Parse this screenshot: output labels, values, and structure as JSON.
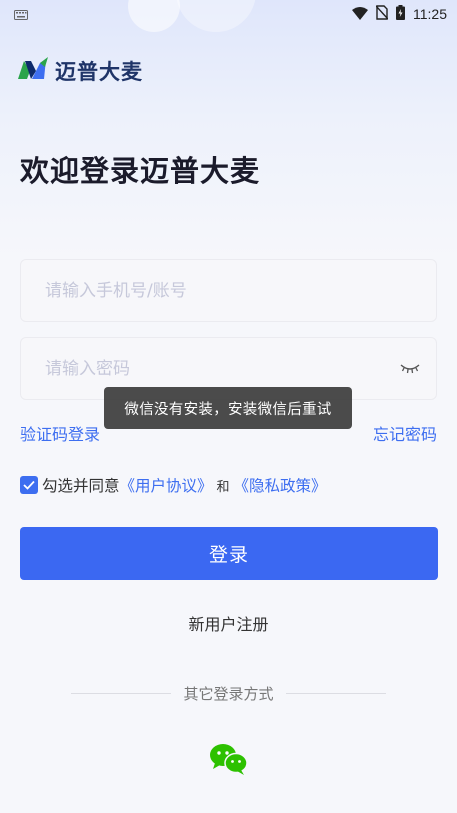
{
  "status_bar": {
    "time": "11:25",
    "icons": [
      "keyboard-icon",
      "wifi-icon",
      "no-sim-icon",
      "battery-icon"
    ]
  },
  "brand": {
    "logo_text": "迈普大麦",
    "logo_colors": [
      "#2aa44a",
      "#3d6ef0",
      "#0d2a6b"
    ]
  },
  "welcome_title": "欢迎登录迈普大麦",
  "account_input": {
    "placeholder": "请输入手机号/账号",
    "value": ""
  },
  "password_input": {
    "placeholder": "请输入密码",
    "value": "",
    "visibility_icon": "eye-closed-icon"
  },
  "links": {
    "sms_login": "验证码登录",
    "forgot_password": "忘记密码"
  },
  "toast": "微信没有安装，安装微信后重试",
  "agreement": {
    "checked": true,
    "prefix": "勾选并同意",
    "user_agreement": "《用户协议》",
    "and": "和",
    "privacy_policy": "《隐私政策》"
  },
  "login_button": "登录",
  "register_link": "新用户注册",
  "other_login": {
    "label": "其它登录方式",
    "options": [
      "wechat-icon"
    ]
  },
  "colors": {
    "accent": "#3b68f2",
    "link": "#3d6ef0",
    "wechat": "#2dc100"
  }
}
